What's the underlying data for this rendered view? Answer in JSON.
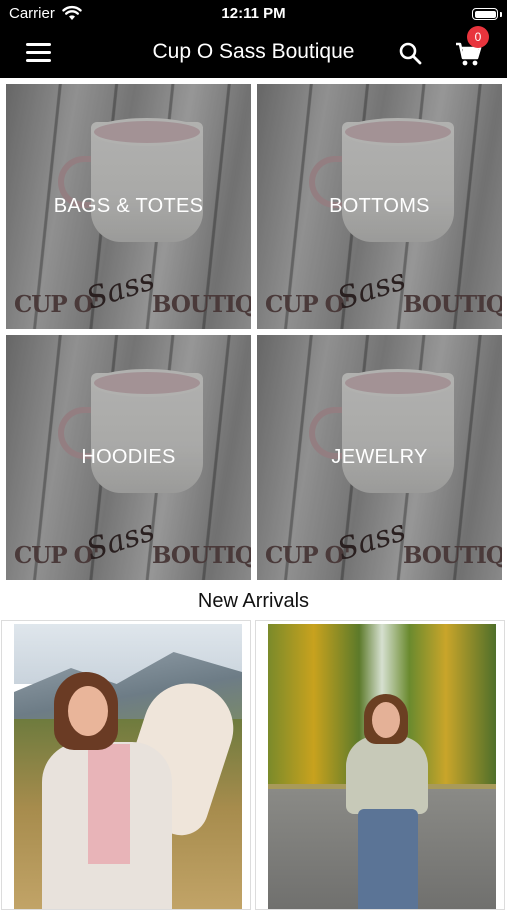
{
  "status_bar": {
    "carrier": "Carrier",
    "time": "12:11 PM"
  },
  "nav": {
    "title": "Cup O Sass Boutique",
    "cart_count": "0",
    "icons": [
      "menu-icon",
      "search-icon",
      "cart-icon"
    ]
  },
  "categories": [
    {
      "label": "BAGS & TOTES"
    },
    {
      "label": "BOTTOMS"
    },
    {
      "label": "HOODIES"
    },
    {
      "label": "JEWELRY"
    }
  ],
  "tile_brand": {
    "left": "CUP O'",
    "script": "Sass",
    "right": "BOUTIQUE"
  },
  "new_arrivals": {
    "title": "New Arrivals"
  },
  "colors": {
    "bar": "#000000",
    "badge": "#e8343d",
    "tile_text": "#ffffff"
  }
}
